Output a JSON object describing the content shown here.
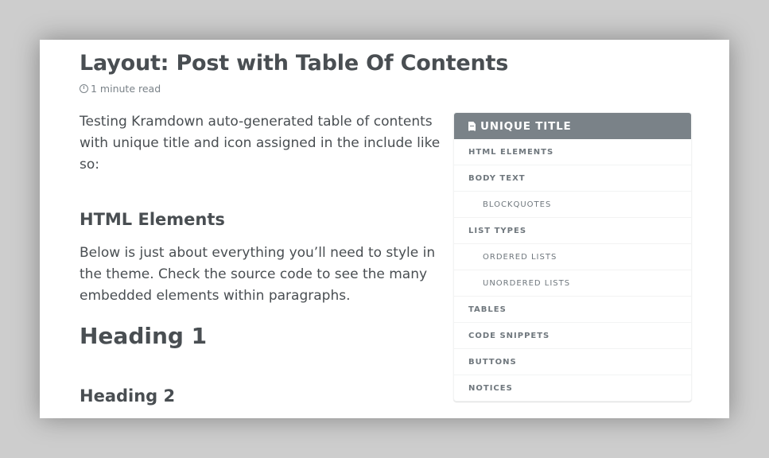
{
  "page": {
    "title": "Layout: Post with Table Of Contents",
    "read_time": "1 minute read",
    "intro": "Testing Kramdown auto-generated table of contents with unique title and icon assigned in the include like so:",
    "section_heading": "HTML Elements",
    "section_text": "Below is just about everything you’ll need to style in the theme. Check the source code to see the many embedded elements within paragraphs.",
    "heading1": "Heading 1",
    "heading2": "Heading 2"
  },
  "toc": {
    "title": "UNIQUE TITLE",
    "icon": "file-text-icon",
    "items": [
      {
        "label": "HTML Elements",
        "level": 1
      },
      {
        "label": "Body Text",
        "level": 1
      },
      {
        "label": "Blockquotes",
        "level": 2
      },
      {
        "label": "List Types",
        "level": 1
      },
      {
        "label": "Ordered Lists",
        "level": 2
      },
      {
        "label": "Unordered Lists",
        "level": 2
      },
      {
        "label": "Tables",
        "level": 1
      },
      {
        "label": "Code Snippets",
        "level": 1
      },
      {
        "label": "Buttons",
        "level": 1
      },
      {
        "label": "Notices",
        "level": 1
      }
    ]
  },
  "colors": {
    "toc_header": "#7a8288",
    "text": "#494e52",
    "background": "#cdcdcd"
  }
}
